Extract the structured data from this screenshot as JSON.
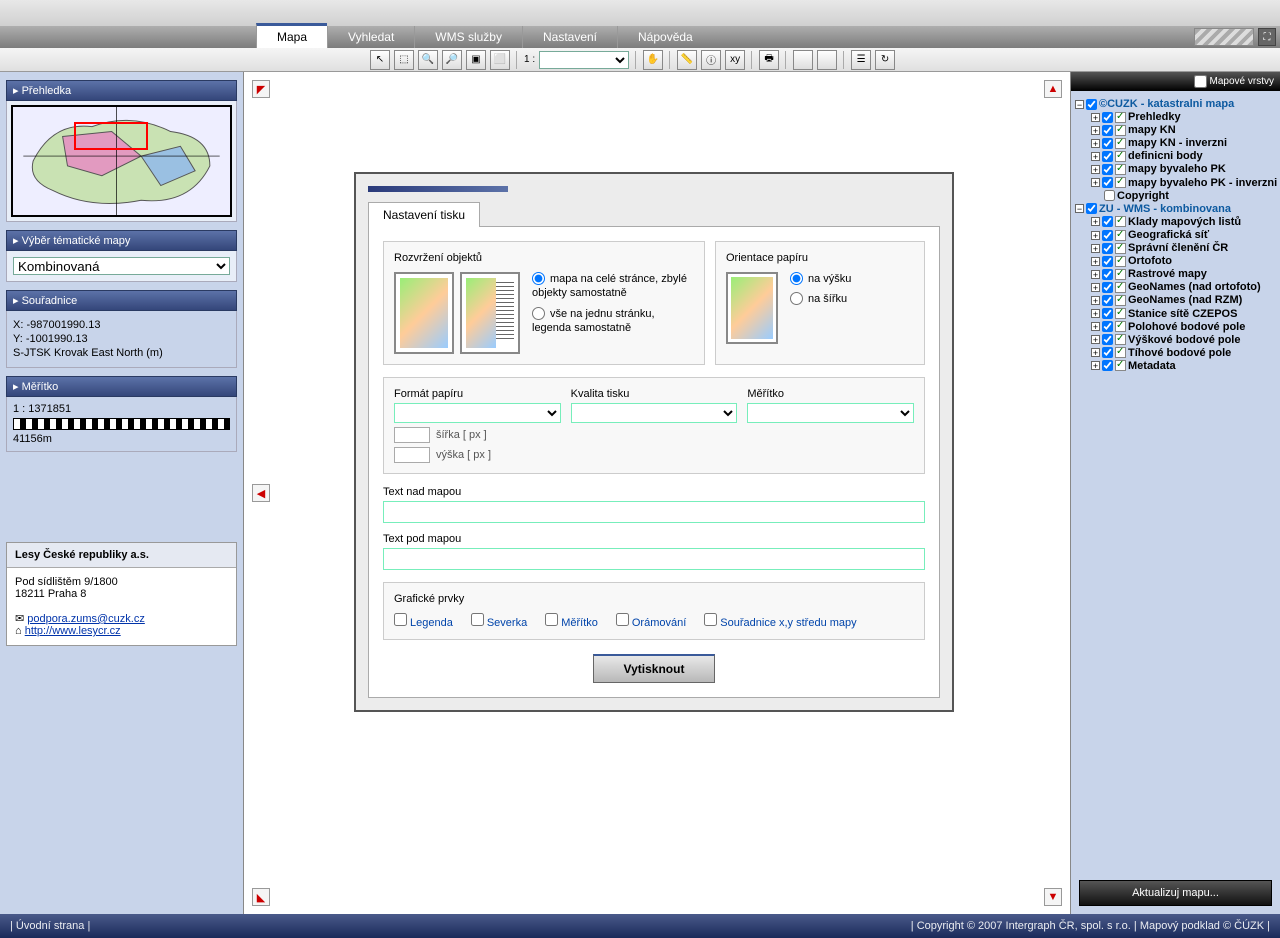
{
  "tabs": [
    "Mapa",
    "Vyhledat",
    "WMS služby",
    "Nastavení",
    "Nápověda"
  ],
  "activeTab": 0,
  "toolbar": {
    "scaleLabel": "1 :",
    "scaleValue": ""
  },
  "rightPanel": {
    "title": "Mapové vrstvy",
    "groups": [
      {
        "label": "©CUZK - katastralni mapa",
        "checked": true,
        "expanded": true,
        "children": [
          {
            "label": "Prehledky"
          },
          {
            "label": "mapy KN"
          },
          {
            "label": "mapy KN - inverzni"
          },
          {
            "label": "definicni body"
          },
          {
            "label": "mapy byvaleho PK"
          },
          {
            "label": "mapy byvaleho PK - inverzni"
          },
          {
            "label": "Copyright",
            "noToggle": true,
            "unchecked": true
          }
        ]
      },
      {
        "label": "ZU - WMS - kombinovana",
        "checked": true,
        "expanded": true,
        "children": [
          {
            "label": "Klady mapových listů"
          },
          {
            "label": "Geografická síť"
          },
          {
            "label": "Správní členění ČR"
          },
          {
            "label": "Ortofoto"
          },
          {
            "label": "Rastrové mapy"
          },
          {
            "label": "GeoNames (nad ortofoto)"
          },
          {
            "label": "GeoNames (nad RZM)"
          },
          {
            "label": "Stanice sítě CZEPOS"
          },
          {
            "label": "Polohové bodové pole"
          },
          {
            "label": "Výškové bodové pole"
          },
          {
            "label": "Tíhové bodové pole"
          },
          {
            "label": "Metadata"
          }
        ]
      }
    ],
    "updateBtn": "Aktualizuj mapu..."
  },
  "leftPanel": {
    "overview": "Přehledka",
    "themeTitle": "Výběr tématické mapy",
    "themeValue": "Kombinovaná",
    "coordsTitle": "Souřadnice",
    "coordX": "X: -987001990.13",
    "coordY": "Y: -1001990.13",
    "coordSys": "S-JTSK Krovak East North (m)",
    "scaleTitle": "Měřítko",
    "scaleRatio": "1 : 1371851",
    "scaleLen": "41156m",
    "company": {
      "name": "Lesy České republiky a.s.",
      "addr1": "Pod sídlištěm 9/1800",
      "addr2": "18211 Praha 8",
      "email": "podpora.zums@cuzk.cz",
      "web": "http://www.lesycr.cz"
    }
  },
  "dialog": {
    "tab": "Nastavení tisku",
    "layoutTitle": "Rozvržení objektů",
    "layoutOpt1": "mapa na celé stránce, zbylé objekty samostatně",
    "layoutOpt2": "vše na jednu stránku, legenda samostatně",
    "orientTitle": "Orientace papíru",
    "orientOpt1": "na výšku",
    "orientOpt2": "na šířku",
    "formatTitle": "Formát papíru",
    "qualityTitle": "Kvalita tisku",
    "scaleTitle": "Měřítko",
    "widthLabel": "šířka [ px ]",
    "heightLabel": "výška [ px ]",
    "textAbove": "Text nad mapou",
    "textBelow": "Text pod mapou",
    "graphicsTitle": "Grafické prvky",
    "chkLegend": "Legenda",
    "chkNorth": "Severka",
    "chkScale": "Měřítko",
    "chkBorder": "Orámování",
    "chkCoords": "Souřadnice x,y středu mapy",
    "printBtn": "Vytisknout"
  },
  "footer": {
    "left": "|  Úvodní strana  |",
    "right": "|  Copyright © 2007 Intergraph ČR, spol. s r.o.   |  Mapový podklad © ČÚZK  |"
  }
}
